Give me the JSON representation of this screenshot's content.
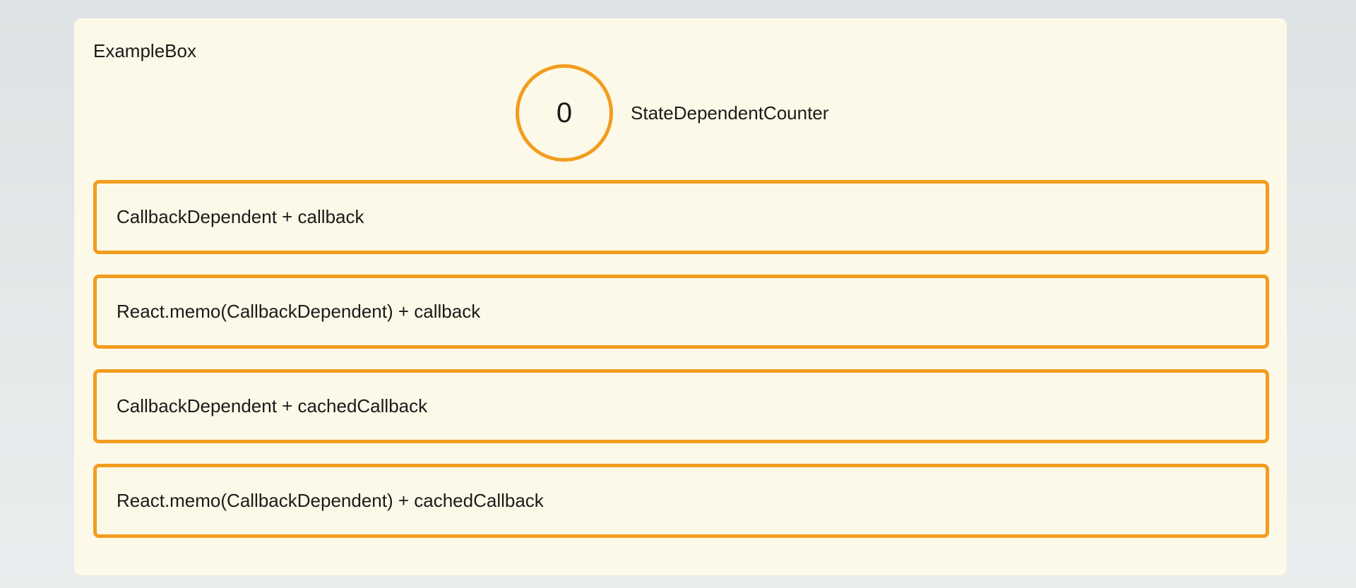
{
  "example_box": {
    "title": "ExampleBox",
    "counter": {
      "value": "0",
      "label": "StateDependentCounter"
    },
    "items": [
      {
        "label": "CallbackDependent + callback"
      },
      {
        "label": "React.memo(CallbackDependent) + callback"
      },
      {
        "label": "CallbackDependent + cachedCallback"
      },
      {
        "label": "React.memo(CallbackDependent) + cachedCallback"
      }
    ]
  },
  "colors": {
    "accent_border": "#f29d1f",
    "box_background": "#fdf9e8",
    "page_background": "#e3e8e9"
  }
}
